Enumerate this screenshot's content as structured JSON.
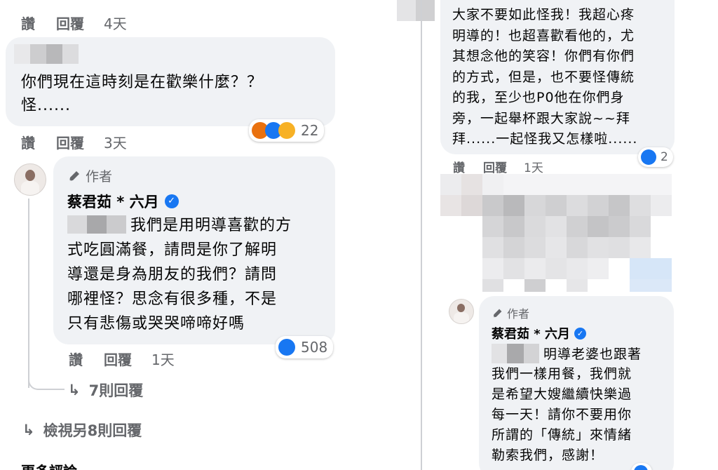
{
  "left": {
    "top_actions": {
      "like": "讚",
      "reply": "回覆",
      "time": "4天"
    },
    "comment1": {
      "text": "你們現在這時刻是在歡樂什麼？？\n怪......"
    },
    "comment1_actions": {
      "like": "讚",
      "reply": "回覆",
      "time": "3天"
    },
    "comment1_reactions": {
      "count": "22",
      "icons": [
        "angry-icon",
        "like-icon",
        "haha-icon"
      ]
    },
    "author_reply": {
      "author_tag": "作者",
      "name": "蔡君茹 * 六月",
      "line1": "我們是用明導喜歡的方",
      "rest": "式吃圓滿餐，請問是你了解明\n導還是身為朋友的我們？請問\n哪裡怪？思念有很多種，不是\n只有悲傷或哭哭啼啼好嗎",
      "reactions": "508",
      "actions": {
        "like": "讚",
        "reply": "回覆",
        "time": "1天"
      }
    },
    "more_replies": "7則回覆",
    "view_more": "檢視另8則回覆",
    "cut_text": "更多評論"
  },
  "right": {
    "comment_text": "大家不要如此怪我！我超心疼\n明導的！也超喜歡看他的，尤\n其想念他的笑容！你們有你們\n的方式，但是，也不要怪傳統\n的我，至少也P0他在你們身\n旁，一起舉杯跟大家說~~拜\n拜......一起怪我又怎樣啦......",
    "comment_reactions": "2",
    "comment_actions": {
      "like": "讚",
      "reply": "回覆",
      "time": "1天"
    },
    "author_reply": {
      "author_tag": "作者",
      "name": "蔡君茹 * 六月",
      "line1": "明導老婆也跟著",
      "rest": "我們一樣用餐，我們就\n是希望大嫂繼續快樂過\n每一天！請你不要用你\n所謂的「傳統」來情緒\n勒索我們，感謝！"
    }
  },
  "colors": {
    "bubble": "#f0f2f5",
    "meta": "#65676b",
    "link": "#1877f2",
    "text": "#050505"
  }
}
